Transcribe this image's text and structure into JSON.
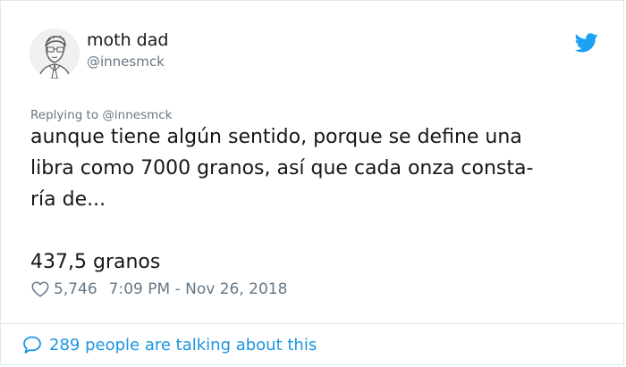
{
  "author": {
    "name": "moth dad",
    "handle": "@innesmck"
  },
  "tweet": {
    "reply_context": "Replying to @innesmck",
    "lines": [
      "aunque tiene algún sentido, porque se define una",
      "libra como 7000 granos, así que cada onza consta-",
      "ría de...",
      "437,5 granos"
    ]
  },
  "meta": {
    "likes": "5,746",
    "timestamp": "7:09 PM - Nov 26, 2018"
  },
  "footer": {
    "talking_text": "289 people are talking about this"
  },
  "icons": {
    "twitter_logo": "twitter-bird-icon",
    "like": "heart-icon",
    "talking": "speech-bubble-icon"
  },
  "colors": {
    "twitter_blue": "#1da1f2",
    "link_blue": "#1b95e0",
    "secondary_text": "#657786",
    "primary_text": "#14171a",
    "border": "#e1e8ed"
  }
}
